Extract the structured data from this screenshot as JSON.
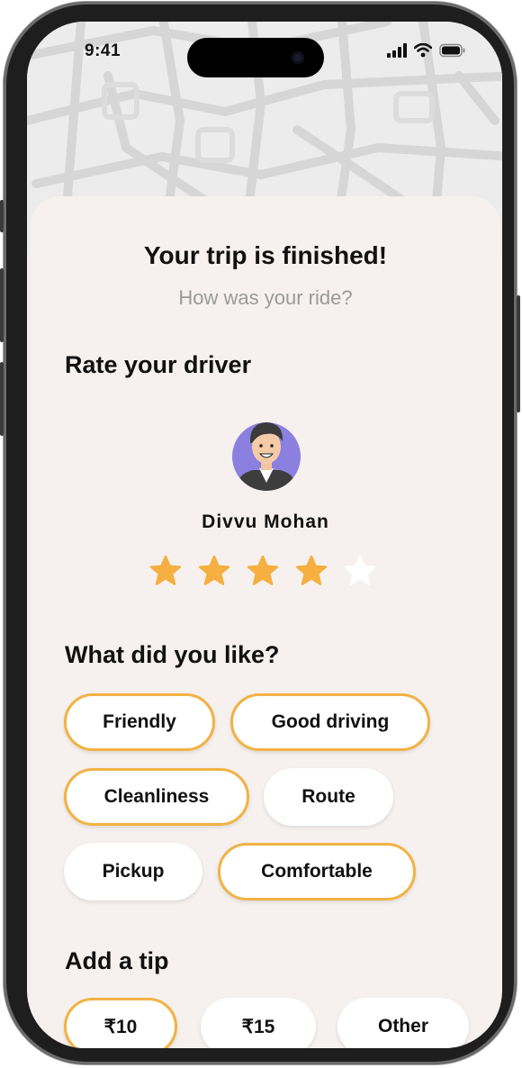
{
  "status_bar": {
    "time": "9:41"
  },
  "header": {
    "title": "Your trip is finished!",
    "subtitle": "How was your ride?"
  },
  "rating": {
    "section_title": "Rate your driver",
    "driver_name": "Divvu Mohan",
    "stars_value": 4,
    "stars_max": 5
  },
  "likes": {
    "section_title": "What did you like?",
    "options": [
      {
        "label": "Friendly",
        "selected": true
      },
      {
        "label": "Good driving",
        "selected": true
      },
      {
        "label": "Cleanliness",
        "selected": true
      },
      {
        "label": "Route",
        "selected": false
      },
      {
        "label": "Pickup",
        "selected": false
      },
      {
        "label": "Comfortable",
        "selected": true
      }
    ]
  },
  "tip": {
    "section_title": "Add a tip",
    "options": [
      {
        "label": "₹10",
        "selected": true
      },
      {
        "label": "₹15",
        "selected": false
      },
      {
        "label": "Other",
        "selected": false
      }
    ]
  },
  "colors": {
    "accent": "#f2b244",
    "star_filled": "#f5b041",
    "star_empty": "#ffffff",
    "avatar_bg": "#8b7fe0",
    "sheet_bg": "#f6f1ef"
  }
}
